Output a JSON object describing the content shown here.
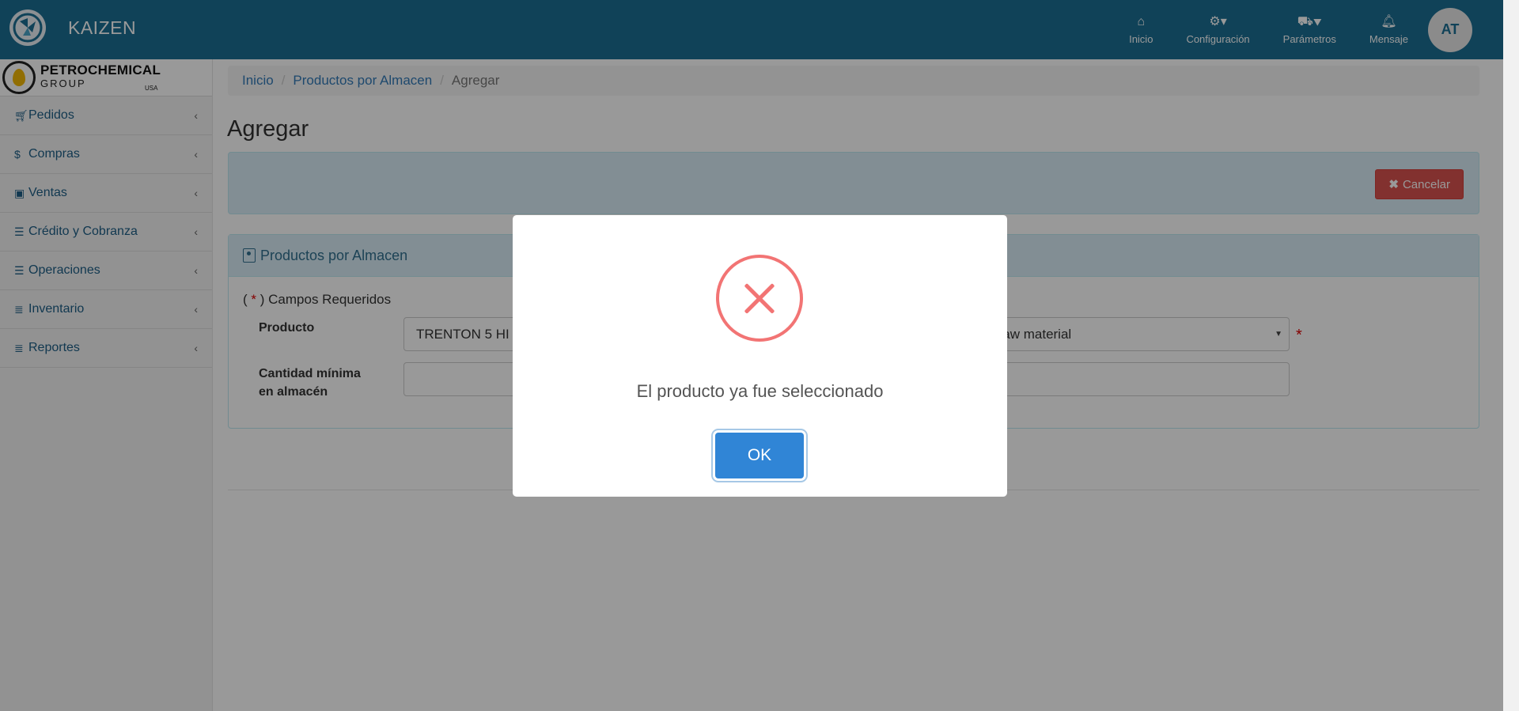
{
  "app": {
    "name": "KAIZEN"
  },
  "topnav": {
    "items": [
      {
        "label": "Inicio",
        "icon": "home-icon"
      },
      {
        "label": "Configuración",
        "icon": "gear-icon"
      },
      {
        "label": "Parámetros",
        "icon": "truck-icon"
      },
      {
        "label": "Mensaje",
        "icon": "bell-icon"
      }
    ],
    "avatar_initials": "AT"
  },
  "sidebar": {
    "logo": {
      "line1": "PETROCHEMICAL",
      "line2": "GROUP",
      "line3": "USA"
    },
    "items": [
      {
        "label": "Pedidos",
        "icon": "cart-icon"
      },
      {
        "label": "Compras",
        "icon": "dollar-icon"
      },
      {
        "label": "Ventas",
        "icon": "money-icon"
      },
      {
        "label": "Crédito y Cobranza",
        "icon": "sliders-icon"
      },
      {
        "label": "Operaciones",
        "icon": "sliders-icon"
      },
      {
        "label": "Inventario",
        "icon": "list-icon"
      },
      {
        "label": "Reportes",
        "icon": "list-icon"
      }
    ]
  },
  "breadcrumb": {
    "home": "Inicio",
    "section": "Productos por Almacen",
    "current": "Agregar"
  },
  "page": {
    "title": "Agregar",
    "cancel_label": "Cancelar"
  },
  "form": {
    "panel_title": "Productos por Almacen",
    "required_note_prefix": "(",
    "required_star": "*",
    "required_note_suffix": ") Campos Requeridos",
    "product_label": "Producto",
    "product_value": "TRENTON 5 HI",
    "warehouse_value": "Raw material",
    "min_qty_label_1": "Cantidad mínima",
    "min_qty_label_2": "en almacén"
  },
  "modal": {
    "icon": "error-icon",
    "message": "El producto ya fue seleccionado",
    "ok_label": "OK"
  },
  "colors": {
    "topbar": "#1c6f93",
    "danger": "#d9534f",
    "ok_button": "#3085d6",
    "error_icon": "#f27474"
  }
}
